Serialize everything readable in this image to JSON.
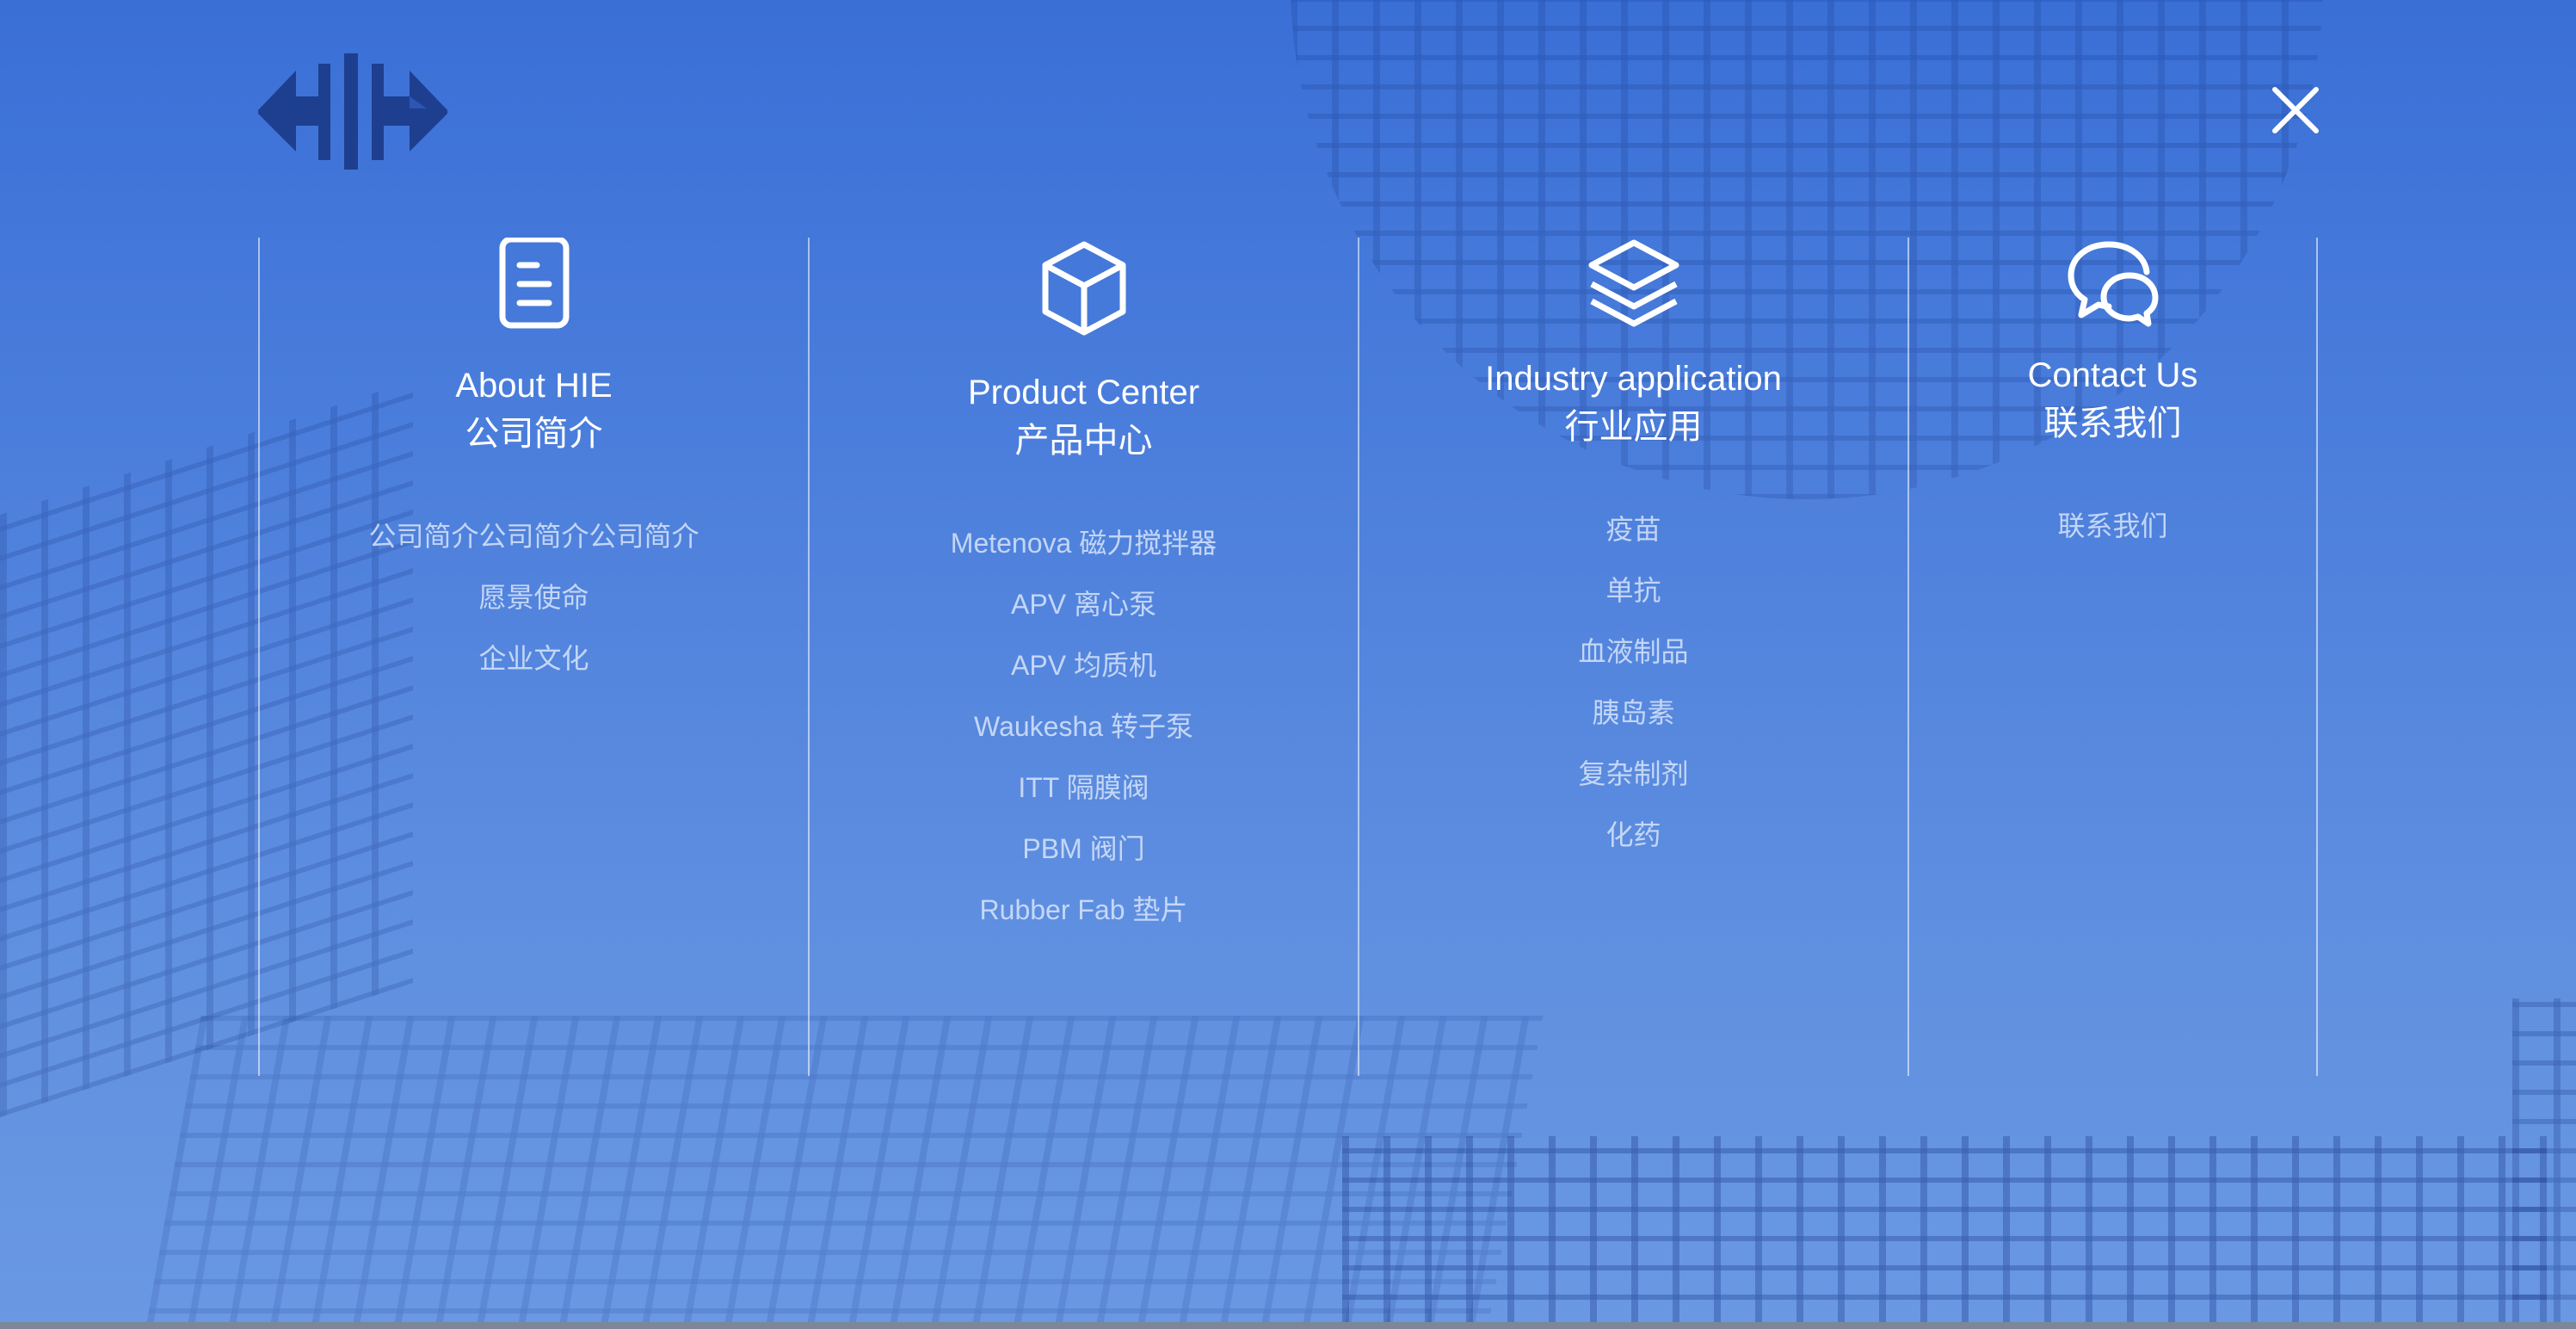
{
  "colors": {
    "background": "#3a6fd6",
    "logo": "#1e3f8f",
    "title_text": "#ffffff",
    "link_text": "#d7e4fa",
    "divider": "#ffffff"
  },
  "header": {
    "logo_icon": "hie-logo",
    "close_icon": "close-icon"
  },
  "columns": [
    {
      "icon": "document-icon",
      "title_en": "About HIE",
      "title_cn": "公司简介",
      "links": [
        "公司简介公司简介公司简介",
        "愿景使命",
        "企业文化"
      ]
    },
    {
      "icon": "cube-icon",
      "title_en": "Product Center",
      "title_cn": "产品中心",
      "links": [
        "Metenova 磁力搅拌器",
        "APV 离心泵",
        "APV 均质机",
        "Waukesha 转子泵",
        "ITT 隔膜阀",
        "PBM 阀门",
        "Rubber Fab 垫片"
      ]
    },
    {
      "icon": "layers-icon",
      "title_en": "Industry application",
      "title_cn": "行业应用",
      "links": [
        "疫苗",
        "单抗",
        "血液制品",
        "胰岛素",
        "复杂制剂",
        "化药"
      ]
    },
    {
      "icon": "chat-icon",
      "title_en": "Contact Us",
      "title_cn": "联系我们",
      "links": [
        "联系我们"
      ]
    }
  ]
}
